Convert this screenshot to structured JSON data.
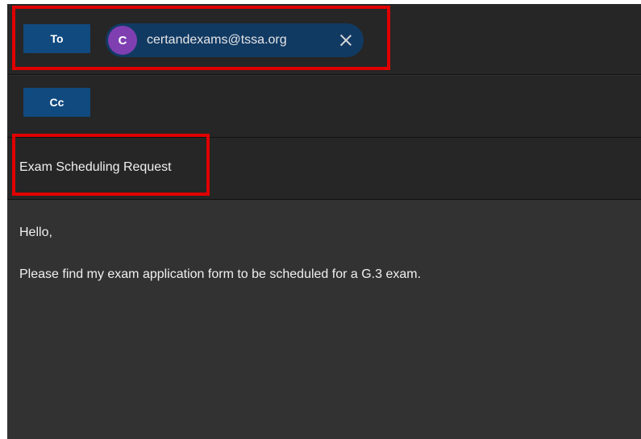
{
  "recipients": {
    "to_label": "To",
    "cc_label": "Cc",
    "to_chip": {
      "avatar_initial": "C",
      "email": "certandexams@tssa.org",
      "avatar_color": "#7f3fb1"
    }
  },
  "subject": "Exam Scheduling Request",
  "body": {
    "lines": [
      "Hello,",
      "Please find my exam application form to be scheduled for a G.3 exam."
    ]
  },
  "colors": {
    "field_button": "#104a7f",
    "chip_background": "#113a63",
    "highlight": "#e00000",
    "panel_background": "#262626",
    "body_background": "#323232"
  }
}
